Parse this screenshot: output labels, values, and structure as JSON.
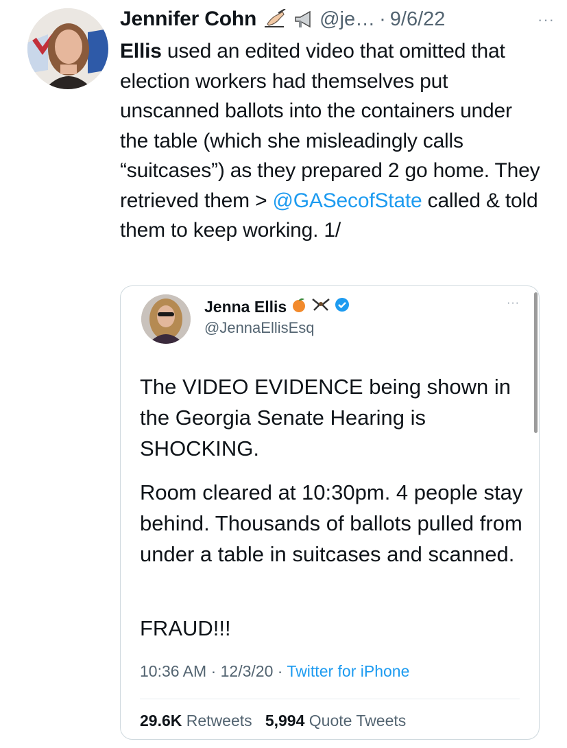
{
  "tweet": {
    "author_name": "Jennifer Cohn",
    "author_emojis": [
      "writing-hand-icon",
      "megaphone-icon"
    ],
    "handle": "@je…",
    "separator": "·",
    "date": "9/6/22",
    "more_label": "···",
    "text": {
      "part1_bold": "Ellis",
      "part2": " used an edited video that omitted that election workers had themselves put unscanned ballots into the containers under the table (which she misleadingly calls “suitcases”) as they prepared 2 go home. They retrieved them > ",
      "mention": "@GASecofState",
      "part3": " called & told them to keep working. 1/"
    }
  },
  "quoted": {
    "name": "Jenna Ellis",
    "emojis": [
      "peach-icon",
      "eagle-icon",
      "verified-badge-icon"
    ],
    "handle": "@JennaEllisEsq",
    "more_label": "···",
    "paragraphs": [
      "The VIDEO EVIDENCE being shown in the Georgia Senate Hearing is SHOCKING.",
      "Room cleared at 10:30pm. 4 people stay behind. Thousands of ballots pulled from under a table in suitcases and scanned.",
      "FRAUD!!!"
    ],
    "time": "10:36 AM",
    "date": "12/3/20",
    "source": "Twitter for iPhone",
    "retweets_count": "29.6K",
    "retweets_label": "Retweets",
    "quotes_count": "5,994",
    "quotes_label": "Quote Tweets"
  },
  "colors": {
    "link": "#1d9bf0",
    "secondary_text": "#536471",
    "border": "#cfd9de"
  }
}
